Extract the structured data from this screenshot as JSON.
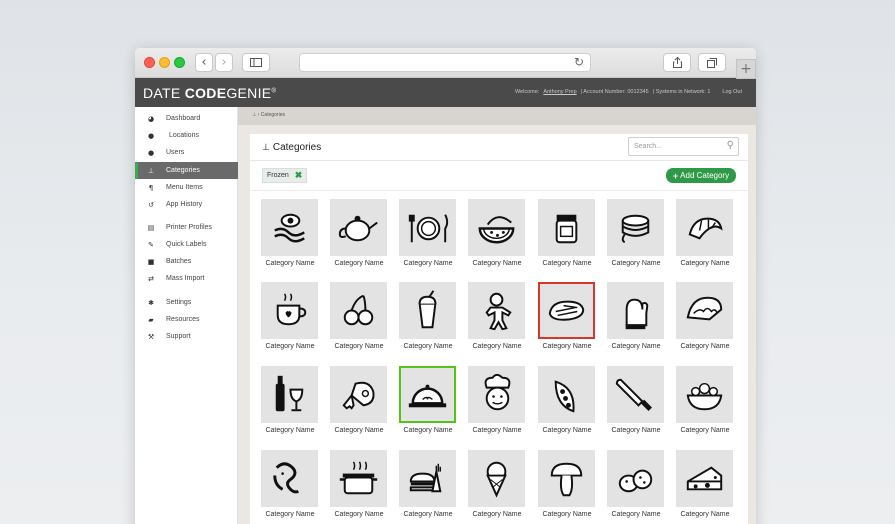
{
  "browser": {
    "new_tab": "+"
  },
  "header": {
    "logo_light": "DATE ",
    "logo_bold": "CODE",
    "logo_rest": "GENIE",
    "logo_mark": "®",
    "welcome_label": "Welcome:",
    "user": "Anthony Prep",
    "account": "| Account Number: 0012345",
    "systems": "| Systems in Network: 1",
    "logout": "Log Out"
  },
  "sidebar": {
    "items": [
      {
        "label": "Dashboard",
        "icon": "dashboard-icon"
      },
      {
        "label": "Locations",
        "icon": "map-pin-icon"
      },
      {
        "label": "Users",
        "icon": "user-icon"
      },
      {
        "label": "Categories",
        "icon": "sitemap-icon"
      },
      {
        "label": "Menu Items",
        "icon": "cutlery-icon"
      },
      {
        "label": "App History",
        "icon": "history-icon"
      },
      {
        "label": "Printer Profiles",
        "icon": "printer-icon"
      },
      {
        "label": "Quick Labels",
        "icon": "edit-icon"
      },
      {
        "label": "Batches",
        "icon": "archive-icon"
      },
      {
        "label": "Mass Import",
        "icon": "exchange-icon"
      },
      {
        "label": "Settings",
        "icon": "gear-icon"
      },
      {
        "label": "Resources",
        "icon": "book-icon"
      },
      {
        "label": "Support",
        "icon": "wrench-icon"
      }
    ]
  },
  "breadcrumb": "› Categories",
  "page": {
    "title": "Categories",
    "search_placeholder": "Search...",
    "filter_tag": "Frozen",
    "add_button": "Add Category"
  },
  "categories": [
    {
      "label": "Category Name",
      "icon": "bacon-egg-icon"
    },
    {
      "label": "Category Name",
      "icon": "teapot-icon"
    },
    {
      "label": "Category Name",
      "icon": "plate-cutlery-icon"
    },
    {
      "label": "Category Name",
      "icon": "watermelon-icon"
    },
    {
      "label": "Category Name",
      "icon": "jam-jar-icon"
    },
    {
      "label": "Category Name",
      "icon": "pancakes-icon"
    },
    {
      "label": "Category Name",
      "icon": "croissant-icon"
    },
    {
      "label": "Category Name",
      "icon": "coffee-cup-icon"
    },
    {
      "label": "Category Name",
      "icon": "cherries-icon"
    },
    {
      "label": "Category Name",
      "icon": "milkshake-icon"
    },
    {
      "label": "Category Name",
      "icon": "gingerbread-icon"
    },
    {
      "label": "Category Name",
      "icon": "steak-icon"
    },
    {
      "label": "Category Name",
      "icon": "oven-mitt-icon"
    },
    {
      "label": "Category Name",
      "icon": "taco-icon"
    },
    {
      "label": "Category Name",
      "icon": "wine-icon"
    },
    {
      "label": "Category Name",
      "icon": "ham-leg-icon"
    },
    {
      "label": "Category Name",
      "icon": "cloche-icon"
    },
    {
      "label": "Category Name",
      "icon": "chef-icon"
    },
    {
      "label": "Category Name",
      "icon": "peas-icon"
    },
    {
      "label": "Category Name",
      "icon": "knife-icon"
    },
    {
      "label": "Category Name",
      "icon": "salad-bowl-icon"
    },
    {
      "label": "Category Name",
      "icon": "octopus-icon"
    },
    {
      "label": "Category Name",
      "icon": "cooking-pot-icon"
    },
    {
      "label": "Category Name",
      "icon": "burger-fries-icon"
    },
    {
      "label": "Category Name",
      "icon": "ice-cream-icon"
    },
    {
      "label": "Category Name",
      "icon": "mushroom-icon"
    },
    {
      "label": "Category Name",
      "icon": "potatoes-icon"
    },
    {
      "label": "Category Name",
      "icon": "cheese-icon"
    }
  ],
  "colors": {
    "accent_green": "#2e9a48",
    "selected_red": "#d9362b",
    "selected_green": "#52c41a",
    "header_dark": "#4a4a4a"
  }
}
